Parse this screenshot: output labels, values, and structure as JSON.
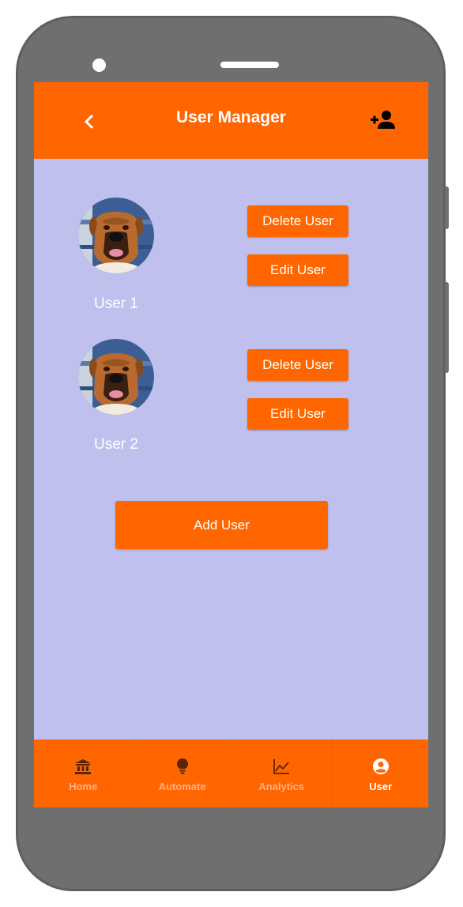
{
  "app": {
    "title": "User Manager"
  },
  "users": [
    {
      "name": "User 1",
      "delete_label": "Delete User",
      "edit_label": "Edit User"
    },
    {
      "name": "User 2",
      "delete_label": "Delete User",
      "edit_label": "Edit User"
    }
  ],
  "add_user_label": "Add User",
  "nav": {
    "items": [
      {
        "label": "Home",
        "icon": "bank-icon",
        "active": false
      },
      {
        "label": "Automate",
        "icon": "lightbulb-icon",
        "active": false
      },
      {
        "label": "Analytics",
        "icon": "line-chart-icon",
        "active": false
      },
      {
        "label": "User",
        "icon": "account-circle-icon",
        "active": true
      }
    ]
  },
  "colors": {
    "accent": "#ff6600",
    "background": "#bfc0ee",
    "phone_frame": "#6f6f6f",
    "nav_inactive": "#ffb08a",
    "text_light": "#ffffff"
  }
}
